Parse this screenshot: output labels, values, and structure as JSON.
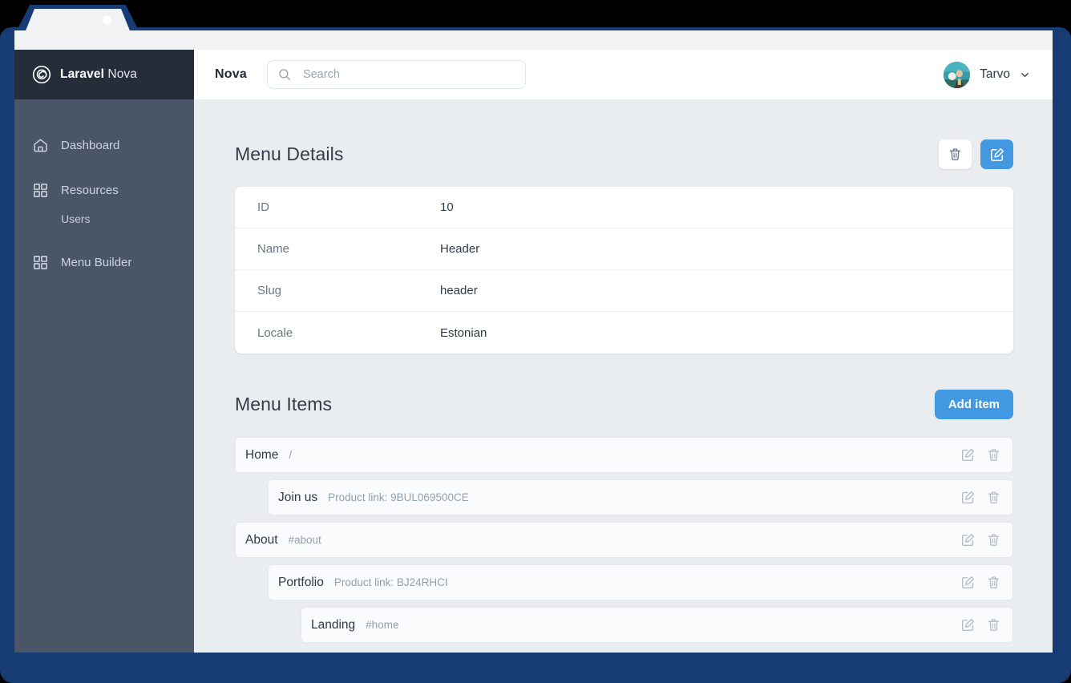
{
  "colors": {
    "frame": "#173c73",
    "sidebar": "#4a5568",
    "sidebar_brand": "#252d3a",
    "accent": "#4299e1",
    "page_bg": "#eaedf0"
  },
  "brand": {
    "name_bold": "Laravel",
    "name_light": "Nova",
    "logo_icon": "nova-spiral-icon"
  },
  "sidebar": {
    "items": [
      {
        "label": "Dashboard",
        "icon": "home-icon",
        "level": 0
      },
      {
        "label": "Resources",
        "icon": "grid-icon",
        "level": 0
      },
      {
        "label": "Users",
        "icon": "",
        "level": 1
      },
      {
        "label": "Menu Builder",
        "icon": "grid-icon",
        "level": 0
      }
    ]
  },
  "topbar": {
    "title": "Nova",
    "search": {
      "placeholder": "Search",
      "value": "",
      "icon": "search-icon"
    },
    "user": {
      "name": "Tarvo",
      "chevron_icon": "chevron-down-icon",
      "avatar_icon": "avatar"
    }
  },
  "details": {
    "title": "Menu Details",
    "actions": [
      {
        "name": "delete",
        "icon": "trash-icon",
        "style": "white"
      },
      {
        "name": "edit",
        "icon": "edit-square-icon",
        "style": "blue"
      }
    ],
    "rows": [
      {
        "label": "ID",
        "value": "10"
      },
      {
        "label": "Name",
        "value": "Header"
      },
      {
        "label": "Slug",
        "value": "header"
      },
      {
        "label": "Locale",
        "value": "Estonian"
      }
    ]
  },
  "menu_items": {
    "title": "Menu Items",
    "add_label": "Add item",
    "row_actions": {
      "edit_icon": "edit-square-icon",
      "delete_icon": "trash-icon"
    },
    "items": [
      {
        "title": "Home",
        "meta": "/",
        "level": 0
      },
      {
        "title": "Join us",
        "meta": "Product link: 9BUL069500CE",
        "level": 1
      },
      {
        "title": "About",
        "meta": "#about",
        "level": 0
      },
      {
        "title": "Portfolio",
        "meta": "Product link: BJ24RHCI",
        "level": 1
      },
      {
        "title": "Landing",
        "meta": "#home",
        "level": 2
      }
    ]
  }
}
